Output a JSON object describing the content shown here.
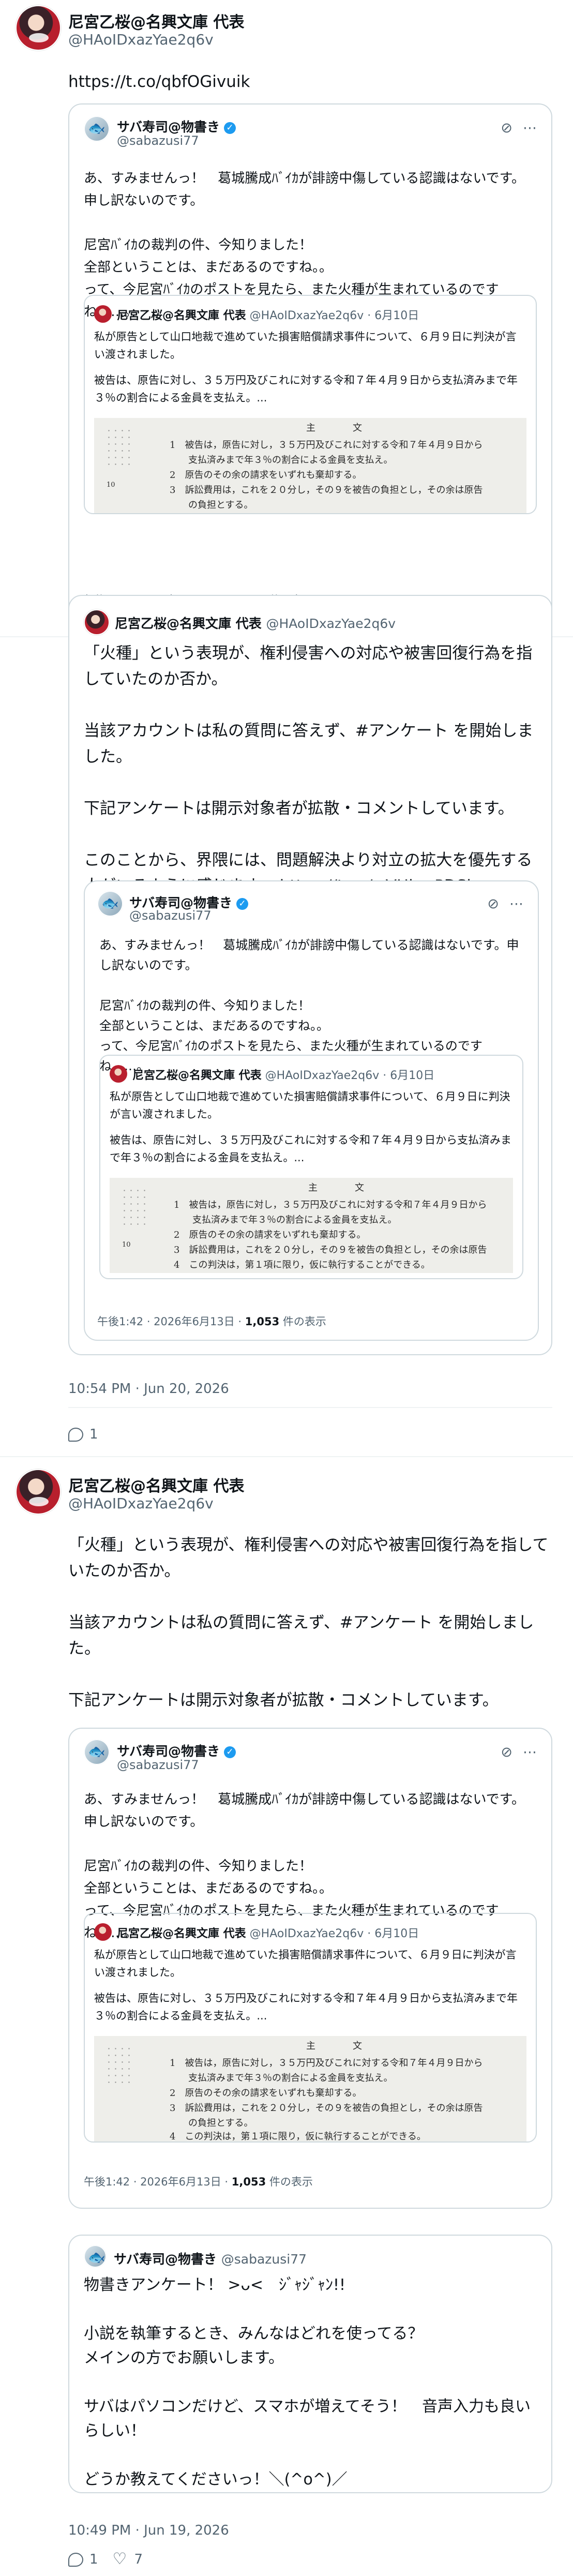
{
  "author": {
    "name": "尼宮乙桜@名興文庫 代表",
    "handle": "@HAoIDxazYae2q6v"
  },
  "post1": {
    "link": "https://t.co/qbfOGivuik"
  },
  "sabaPost": {
    "name": "サバ寿司@物書き",
    "handle": "@sabazusi77",
    "text": "あ、すみませんっ！　葛城騰成ﾊﾞｲｶが誹謗中傷している認識はないです。申し訳ないのです。\n\n尼宮ﾊﾞｲｶの裁判の件、今知りました！\n全部ということは、まだあるのですね。。\nって、今尼宮ﾊﾞｲｶのポストを見たら、また火種が生まれているのですね……。",
    "timestamp": "午後1:42 · 2026年6月13日 ·",
    "views": "1,053",
    "views_label": "件の表示"
  },
  "lawsuitQuote": {
    "name": "尼宮乙桜@名興文庫 代表",
    "handle": "@HAoIDxazYae2q6v",
    "date": "· 6月10日",
    "line1": "私が原告として山口地裁で進めていた損害賠償請求事件について、６月９日に判決が言い渡されました。",
    "line2": "被告は、原告に対し、３５万円及びこれに対する令和７年４月９日から支払済みまで年３％の割合による金員を支払え。..."
  },
  "judgmentImage": {
    "header": "主　　　　文",
    "items": [
      "1　被告は，原告に対し，３５万円及びこれに対する令和７年４月９日から",
      "　　支払済みまで年３％の割合による金員を支払え。",
      "2　原告のその余の請求をいずれも棄却する。",
      "3　訴訟費用は，これを２０分し，その９を被告の負担とし，その余は原告",
      "　　の負担とする。",
      "4　この判決は，第１項に限り，仮に執行することができる。"
    ],
    "page_number": "10"
  },
  "post2": {
    "text": "「火種」という表現が、権利侵害への対応や被害回復行為を指していたのか否か。\n\n当該アカウントは私の質問に答えず、#アンケート を開始しました。\n\n下記アンケートは開示対象者が拡散・コメントしています。\n\nこのことから、界隈には、問題解決より対立の拡大を優先する人がいるように感じます。 https://t.co/wVHbmPDSbv",
    "timestamp": "10:54 PM · Jun 20, 2026",
    "replies": "1"
  },
  "post3": {
    "text": "「火種」という表現が、権利侵害への対応や被害回復行為を指していたのか否か。\n\n当該アカウントは私の質問に答えず、#アンケート を開始しました。\n\n下記アンケートは開示対象者が拡散・コメントしています。\n\nこのことから、界隈には、問題解決より対立の拡大を優先する人がいるように感じます。 https://t.co/wVHbmPDSbv",
    "timestamp": "10:49 PM · Jun 19, 2026",
    "replies": "1",
    "likes": "7"
  },
  "surveyPost": {
    "name": "サバ寿司@物書き",
    "handle": "@sabazusi77",
    "text": "物書きアンケート！ >ᴗ<　ｼﾞｬｼﾞｬﾝ!!\n\n小説を執筆するとき、みんなはどれを使ってる？\nメインの方でお願いします。\n\nサバはパソコンだけど、スマホが増えてそう！　音声入力も良いらしい！\n\nどうか教えてくださいっ！＼(^o^)／"
  },
  "icons": {
    "more": "more-icon",
    "grok": "grok-icon",
    "reply": "comment-icon",
    "like": "heart-icon",
    "verified": "verified-icon"
  },
  "colors": {
    "text": "#0f1419",
    "secondary": "#536471",
    "border": "#cfd9de",
    "verified": "#1d9bf0"
  }
}
